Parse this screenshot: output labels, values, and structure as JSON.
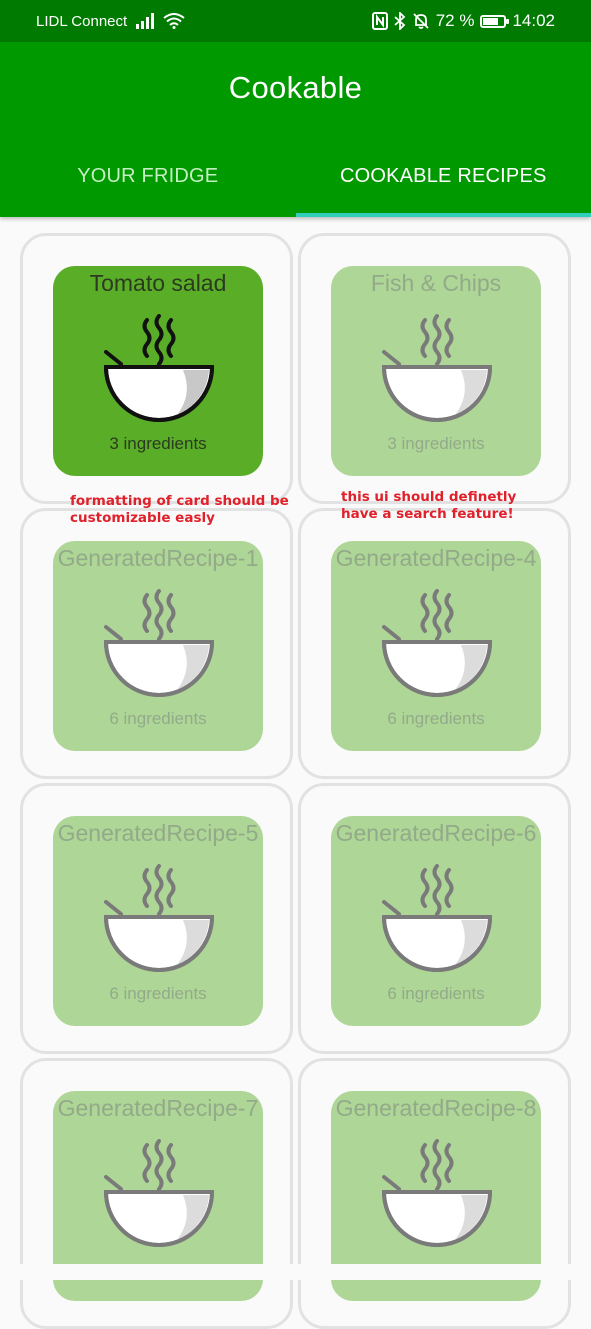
{
  "status_bar": {
    "carrier": "LIDL Connect",
    "battery_percent": "72 %",
    "battery_level": 0.72,
    "time": "14:02"
  },
  "app_bar": {
    "title": "Cookable"
  },
  "tabs": [
    {
      "label": "YOUR FRIDGE",
      "active": false
    },
    {
      "label": "COOKABLE RECIPES",
      "active": true
    }
  ],
  "recipes": [
    {
      "title": "Tomato salad",
      "ingredients": "3 ingredients",
      "available": true
    },
    {
      "title": "Fish & Chips",
      "ingredients": "3 ingredients",
      "available": false
    },
    {
      "title": "GeneratedRecipe-1",
      "ingredients": "6 ingredients",
      "available": false
    },
    {
      "title": "GeneratedRecipe-4",
      "ingredients": "6 ingredients",
      "available": false
    },
    {
      "title": "GeneratedRecipe-5",
      "ingredients": "6 ingredients",
      "available": false
    },
    {
      "title": "GeneratedRecipe-6",
      "ingredients": "6 ingredients",
      "available": false
    },
    {
      "title": "GeneratedRecipe-7",
      "ingredients": "",
      "available": false
    },
    {
      "title": "GeneratedRecipe-8",
      "ingredients": "",
      "available": false
    }
  ],
  "annotations": [
    {
      "line1": "formatting of card should be",
      "line2": "customizable easly"
    },
    {
      "line1": "this ui should definetly",
      "line2": "have a search feature!"
    }
  ],
  "colors": {
    "status_bar": "#007a00",
    "app_bar": "#009900",
    "tab_indicator": "#30d0b8",
    "card_available": "#5aad26",
    "card_unavailable": "#aed696",
    "annotation": "#e0202a"
  },
  "icons": {
    "recipe_card": "soup-bowl-icon",
    "signal": "signal-icon",
    "wifi": "wifi-icon",
    "nfc": "nfc-icon",
    "bluetooth": "bluetooth-icon",
    "mute": "bell-off-icon",
    "battery": "battery-icon"
  }
}
